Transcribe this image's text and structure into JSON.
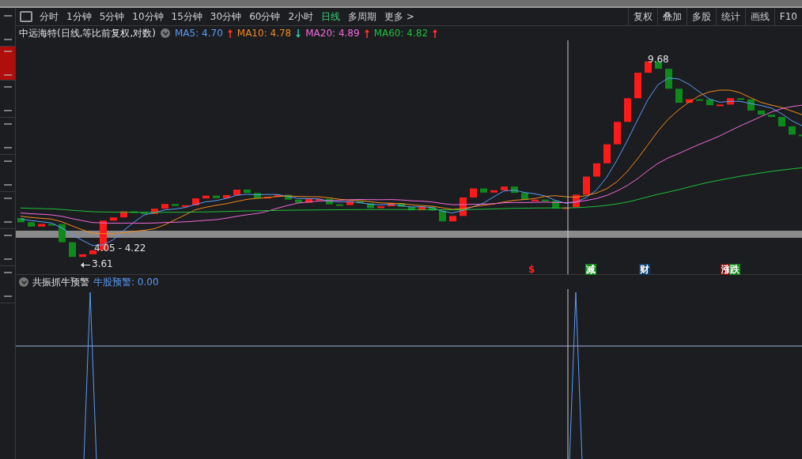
{
  "side_tabs": [
    {
      "selected": false
    },
    {
      "selected": true
    },
    {
      "selected": false
    },
    {
      "selected": false
    },
    {
      "selected": false
    },
    {
      "selected": false
    },
    {
      "selected": false
    },
    {
      "selected": false
    }
  ],
  "toolbar": {
    "periods": [
      {
        "label": "分时",
        "selected": false
      },
      {
        "label": "1分钟",
        "selected": false
      },
      {
        "label": "5分钟",
        "selected": false
      },
      {
        "label": "10分钟",
        "selected": false
      },
      {
        "label": "15分钟",
        "selected": false
      },
      {
        "label": "30分钟",
        "selected": false
      },
      {
        "label": "60分钟",
        "selected": false
      },
      {
        "label": "2小时",
        "selected": false
      },
      {
        "label": "日线",
        "selected": true
      },
      {
        "label": "多周期",
        "selected": false
      }
    ],
    "more": "更多 >",
    "tools": [
      "复权",
      "叠加",
      "多股",
      "统计",
      "画线",
      "F10"
    ]
  },
  "chart": {
    "title": "中远海特(日线,等比前复权,对数)",
    "averages": [
      {
        "name": "MA5:",
        "value": "4.70",
        "color": "#5b9cf5",
        "rising": true
      },
      {
        "name": "MA10:",
        "value": "4.78",
        "color": "#f08a1c",
        "rising": false
      },
      {
        "name": "MA20:",
        "value": "4.89",
        "color": "#f06ad8",
        "rising": true
      },
      {
        "name": "MA60:",
        "value": "4.82",
        "color": "#1fbf3a",
        "rising": true
      }
    ],
    "high_label": "9.68",
    "range_label": "4.05 - 4.22",
    "low_label": "3.61",
    "signals": [
      {
        "text": "$",
        "kind": "plain",
        "color": "#ff2020"
      },
      {
        "text": "减",
        "kind": "tag",
        "color": "#0d8a18"
      },
      {
        "text": "财",
        "kind": "tag",
        "color": "#0c3d6e"
      },
      {
        "text": "涨",
        "kind": "tag",
        "color": "#8a0c0c"
      },
      {
        "text": "跌",
        "kind": "tag",
        "color": "#0d8a18"
      }
    ]
  },
  "indicator": {
    "name": "共振抓牛预警",
    "reading": "牛股预警: 0.00"
  }
}
